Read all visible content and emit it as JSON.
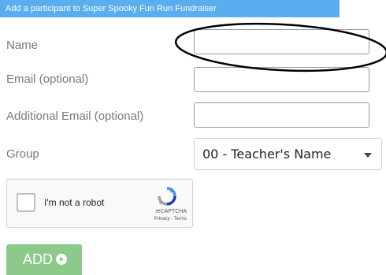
{
  "header": {
    "banner_text": "Add a participant to Super Spooky Fun Run Fundraiser"
  },
  "form": {
    "name_label": "Name",
    "name_value": "",
    "email_label": "Email (optional)",
    "email_value": "",
    "additional_email_label": "Additional Email (optional)",
    "additional_email_value": "",
    "group_label": "Group",
    "group_selected": "00 - Teacher's Name"
  },
  "captcha": {
    "checkbox_label": "I'm not a robot",
    "brand": "reCAPTCHA",
    "privacy_link": "Privacy",
    "separator": " - ",
    "terms_link": "Terms"
  },
  "actions": {
    "add_label": "ADD"
  },
  "annotation": {
    "color": "#000000"
  },
  "colors": {
    "banner": "#5aaef0",
    "add_button": "#8cc98a",
    "label_text": "#7a7a7a"
  }
}
